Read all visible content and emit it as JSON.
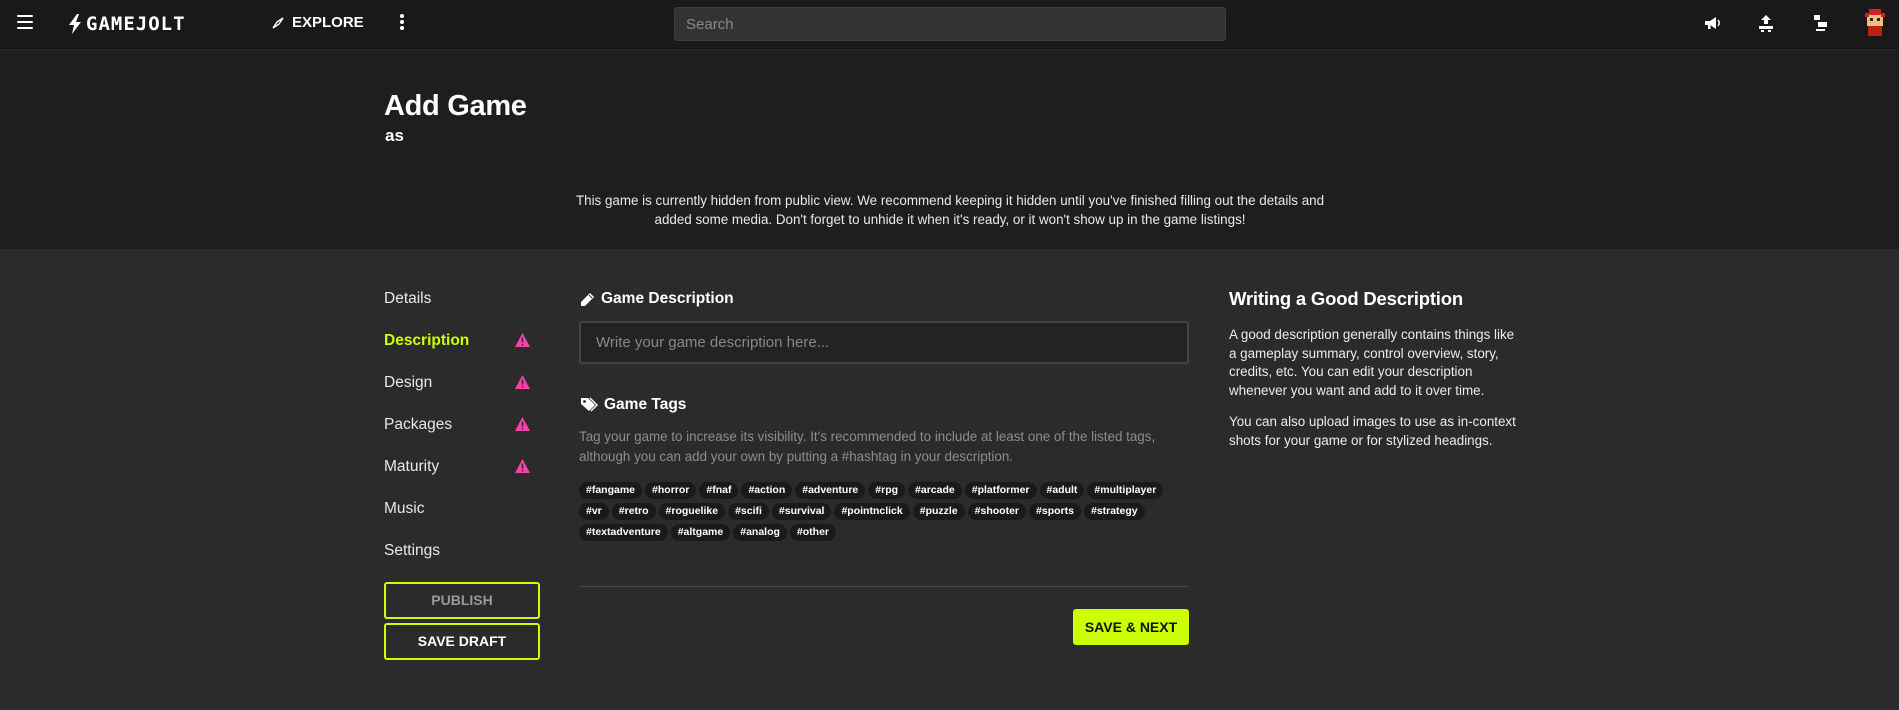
{
  "topbar": {
    "logo_text": "GAMEJOLT",
    "explore_label": "EXPLORE",
    "search_placeholder": "Search",
    "icons": [
      "menu-icon",
      "megaphone-icon",
      "upload-icon",
      "notifications-icon",
      "avatar"
    ]
  },
  "header": {
    "title": "Add Game",
    "subtitle": "as",
    "notice": "This game is currently hidden from public view. We recommend keeping it hidden until you've finished filling out the details and added some media. Don't forget to unhide it when it's ready, or it won't show up in the game listings!"
  },
  "nav": {
    "items": [
      {
        "label": "Details",
        "active": false,
        "warning": false
      },
      {
        "label": "Description",
        "active": true,
        "warning": true
      },
      {
        "label": "Design",
        "active": false,
        "warning": true
      },
      {
        "label": "Packages",
        "active": false,
        "warning": true
      },
      {
        "label": "Maturity",
        "active": false,
        "warning": true
      },
      {
        "label": "Music",
        "active": false,
        "warning": false
      },
      {
        "label": "Settings",
        "active": false,
        "warning": false
      }
    ],
    "publish_label": "PUBLISH",
    "save_draft_label": "SAVE DRAFT"
  },
  "main": {
    "description_title": "Game Description",
    "description_placeholder": "Write your game description here...",
    "description_value": "",
    "tags_title": "Game Tags",
    "tags_help": "Tag your game to increase its visibility. It's recommended to include at least one of the listed tags, although you can add your own by putting a #hashtag in your description.",
    "tags": [
      "#fangame",
      "#horror",
      "#fnaf",
      "#action",
      "#adventure",
      "#rpg",
      "#arcade",
      "#platformer",
      "#adult",
      "#multiplayer",
      "#vr",
      "#retro",
      "#roguelike",
      "#scifi",
      "#survival",
      "#pointnclick",
      "#puzzle",
      "#shooter",
      "#sports",
      "#strategy",
      "#textadventure",
      "#altgame",
      "#analog",
      "#other"
    ],
    "save_next_label": "SAVE & NEXT"
  },
  "sidebar": {
    "title": "Writing a Good Description",
    "p1": "A good description generally contains things like a gameplay summary, control overview, story, credits, etc. You can edit your description whenever you want and add to it over time.",
    "p2": "You can also upload images to use as in-context shots for your game or for stylized headings."
  },
  "colors": {
    "accent": "#ccff00",
    "warning": "#ff3fac",
    "background": "#2b2b2b",
    "header": "#1e1e1e",
    "topbar": "#191919"
  }
}
